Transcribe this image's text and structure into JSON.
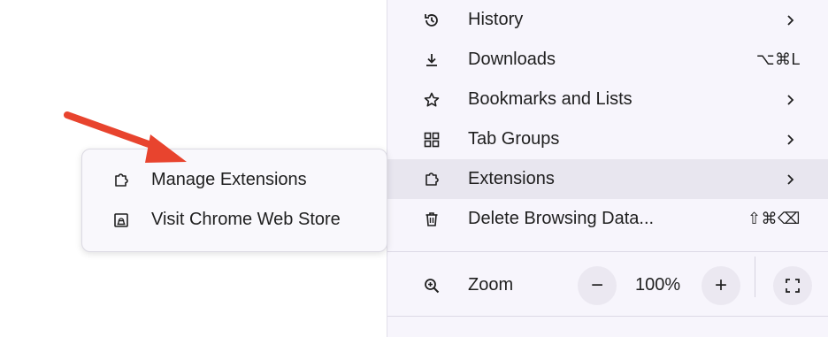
{
  "main_menu": {
    "items": [
      {
        "label": "History",
        "icon": "history-icon",
        "has_submenu": true
      },
      {
        "label": "Downloads",
        "icon": "download-icon",
        "shortcut": "⌥⌘L"
      },
      {
        "label": "Bookmarks and Lists",
        "icon": "star-icon",
        "has_submenu": true
      },
      {
        "label": "Tab Groups",
        "icon": "grid-icon",
        "has_submenu": true
      },
      {
        "label": "Extensions",
        "icon": "puzzle-icon",
        "has_submenu": true,
        "active": true
      },
      {
        "label": "Delete Browsing Data...",
        "icon": "trash-icon",
        "shortcut": "⇧⌘⌫"
      }
    ],
    "zoom": {
      "label": "Zoom",
      "icon": "zoom-icon",
      "decrease": "−",
      "value": "100%",
      "increase": "+",
      "fullscreen_icon": "fullscreen-icon"
    }
  },
  "submenu": {
    "items": [
      {
        "label": "Manage Extensions",
        "icon": "puzzle-icon"
      },
      {
        "label": "Visit Chrome Web Store",
        "icon": "web-store-icon"
      }
    ]
  },
  "annotation": {
    "arrow_color": "#e8442e"
  }
}
